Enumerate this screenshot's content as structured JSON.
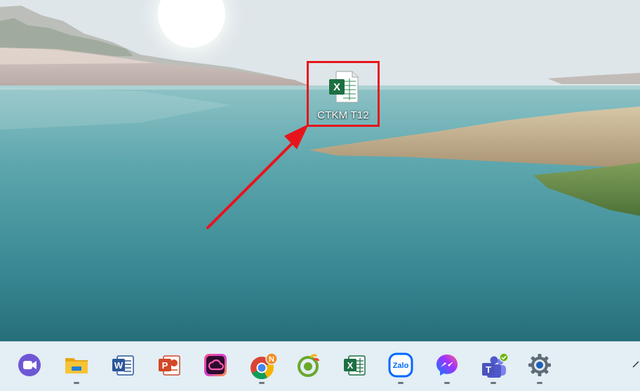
{
  "desktop": {
    "file": {
      "label": "CTKM T12",
      "type_letter": "X"
    }
  },
  "taskbar": {
    "apps": [
      {
        "name": "meet-icon",
        "running": false
      },
      {
        "name": "file-explorer-icon",
        "running": true
      },
      {
        "name": "word-icon",
        "running": false,
        "letter": "W"
      },
      {
        "name": "powerpoint-icon",
        "running": false,
        "letter": "P"
      },
      {
        "name": "creative-cloud-icon",
        "running": false
      },
      {
        "name": "chrome-icon",
        "running": true,
        "badge": "N"
      },
      {
        "name": "coccoc-icon",
        "running": false
      },
      {
        "name": "excel-icon",
        "running": false,
        "letter": "X"
      },
      {
        "name": "zalo-icon",
        "running": true,
        "label": "Zalo"
      },
      {
        "name": "messenger-icon",
        "running": true
      },
      {
        "name": "teams-icon",
        "running": true,
        "letter": "T"
      },
      {
        "name": "settings-icon",
        "running": true
      }
    ]
  },
  "colors": {
    "highlight": "#e8141b",
    "excel_green": "#1d6f42",
    "word_blue": "#2b579a",
    "powerpoint_orange": "#d24726",
    "taskbar_bg": "#e3eef5"
  }
}
